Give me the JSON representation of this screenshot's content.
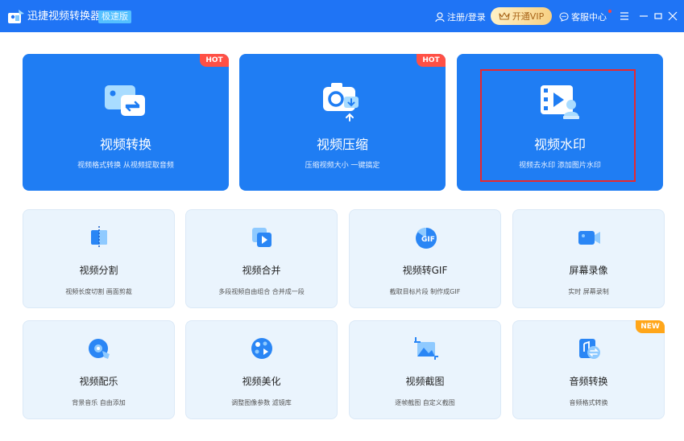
{
  "titlebar": {
    "app_name": "迅捷视频转换器",
    "edition": "极速版",
    "login": "注册/登录",
    "vip": "开通VIP",
    "service": "客服中心"
  },
  "big_cards": [
    {
      "title": "视频转换",
      "desc": "视频格式转换 从视频提取音频",
      "tag": "HOT"
    },
    {
      "title": "视频压缩",
      "desc": "压缩视频大小 一键搞定",
      "tag": "HOT"
    },
    {
      "title": "视频水印",
      "desc": "视频去水印 添加图片水印"
    }
  ],
  "small_cards": [
    {
      "title": "视频分割",
      "desc": "视频长度切割 画面剪裁"
    },
    {
      "title": "视频合并",
      "desc": "多段视频自由组合 合并成一段"
    },
    {
      "title": "视频转GIF",
      "desc": "截取目标片段 制作成GIF"
    },
    {
      "title": "屏幕录像",
      "desc": "实时 屏幕录制"
    },
    {
      "title": "视频配乐",
      "desc": "背景音乐 自由添加"
    },
    {
      "title": "视频美化",
      "desc": "调整图像参数 滤镜库"
    },
    {
      "title": "视频截图",
      "desc": "逐帧截图 自定义截图"
    },
    {
      "title": "音频转换",
      "desc": "音频格式转换",
      "tag": "NEW"
    }
  ],
  "icon_texts": {
    "gif": "GIF"
  },
  "colors": {
    "titlebar": "#1f74f5",
    "big_card": "#1f7df3",
    "small_card": "#eaf4fd",
    "hot": "#ff5045",
    "new": "#ffa61a",
    "highlight": "#e8282e"
  }
}
